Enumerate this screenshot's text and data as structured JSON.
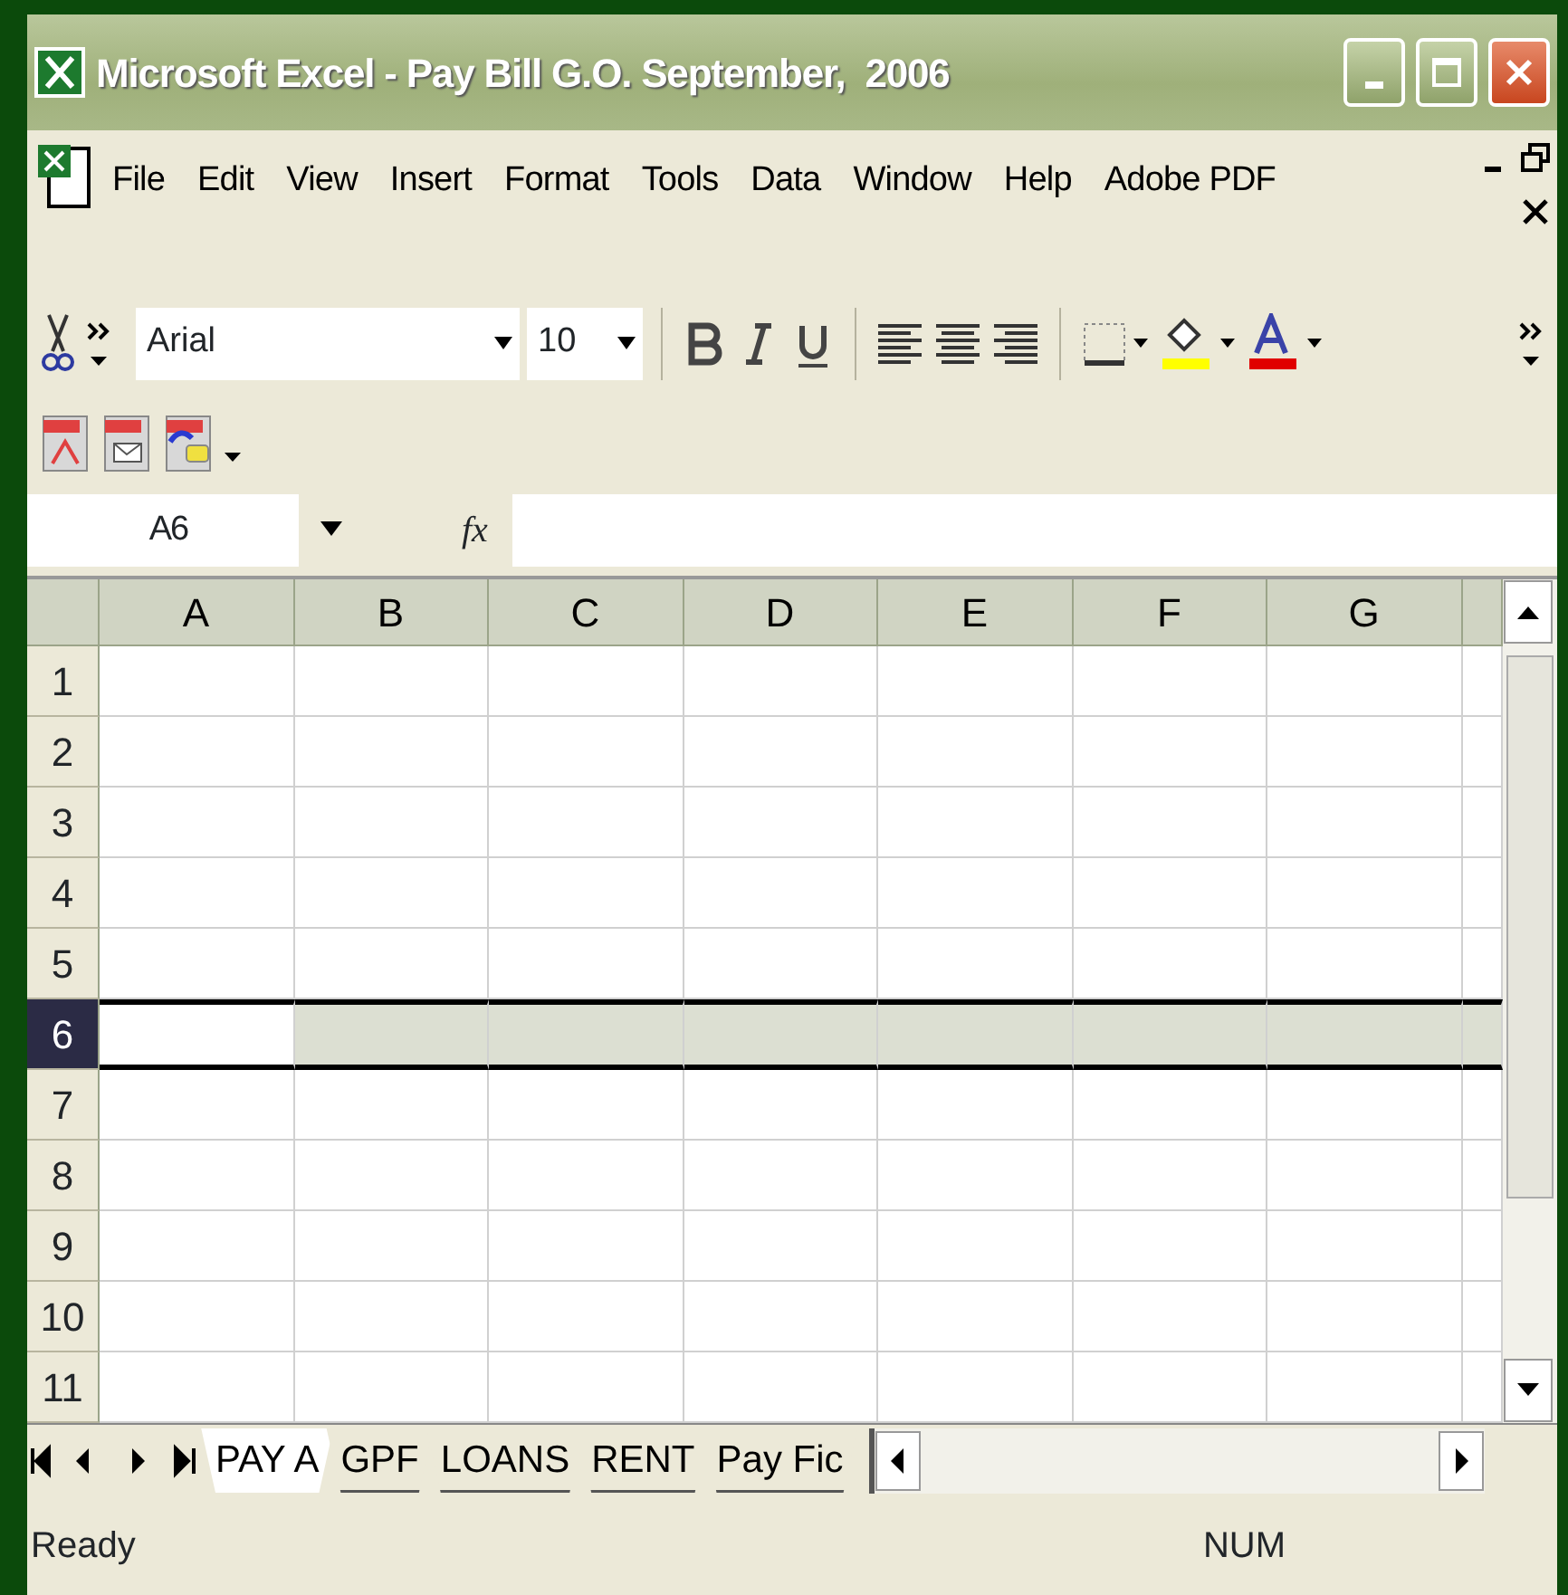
{
  "window": {
    "title": "Microsoft Excel - Pay Bill G.O. September,  2006"
  },
  "menu": [
    {
      "label": "File"
    },
    {
      "label": "Edit"
    },
    {
      "label": "View"
    },
    {
      "label": "Insert"
    },
    {
      "label": "Format"
    },
    {
      "label": "Tools"
    },
    {
      "label": "Data"
    },
    {
      "label": "Window"
    },
    {
      "label": "Help"
    },
    {
      "label": "Adobe PDF"
    }
  ],
  "toolbar": {
    "font": "Arial",
    "size": "10"
  },
  "formula_bar": {
    "name_box": "A6",
    "fx": "fx"
  },
  "columns": [
    {
      "label": "A",
      "active": true
    },
    {
      "label": "B",
      "active": false
    },
    {
      "label": "C",
      "active": false
    },
    {
      "label": "D",
      "active": false
    },
    {
      "label": "E",
      "active": false
    },
    {
      "label": "F",
      "active": false
    },
    {
      "label": "G",
      "active": false
    }
  ],
  "rows": [
    {
      "label": "1",
      "selected": false
    },
    {
      "label": "2",
      "selected": false
    },
    {
      "label": "3",
      "selected": false
    },
    {
      "label": "4",
      "selected": false
    },
    {
      "label": "5",
      "selected": false
    },
    {
      "label": "6",
      "selected": true
    },
    {
      "label": "7",
      "selected": false
    },
    {
      "label": "8",
      "selected": false
    },
    {
      "label": "9",
      "selected": false
    },
    {
      "label": "10",
      "selected": false
    },
    {
      "label": "11",
      "selected": false
    }
  ],
  "sheet_tabs": [
    {
      "label": "PAY A",
      "selected": true
    },
    {
      "label": "GPF",
      "selected": false
    },
    {
      "label": "LOANS",
      "selected": false
    },
    {
      "label": "RENT",
      "selected": false
    },
    {
      "label": "Pay Fic",
      "selected": false
    }
  ],
  "status_bar": {
    "mode": "Ready",
    "indicator": "NUM"
  }
}
